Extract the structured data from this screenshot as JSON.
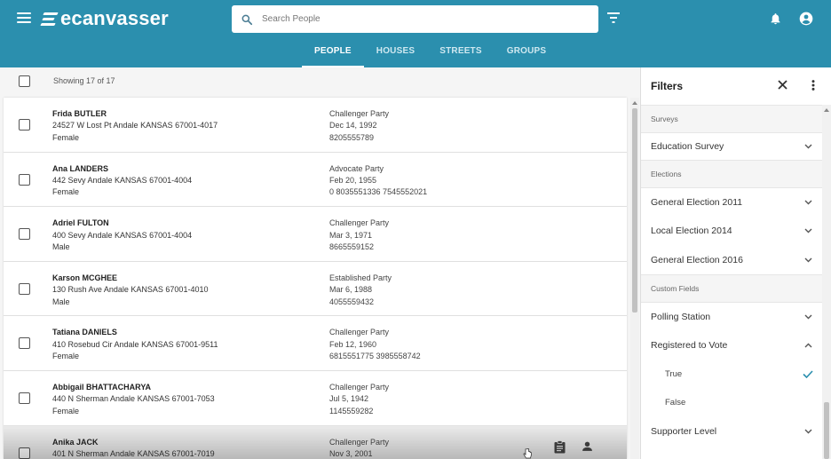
{
  "app": {
    "name": "ecanvasser",
    "brand_color": "#2b8fae"
  },
  "header": {
    "menu_icon": "hamburger-menu-icon",
    "search_placeholder": "Search People",
    "icons": [
      "search-icon",
      "filter-list-icon",
      "bell-icon",
      "account-circle-icon"
    ]
  },
  "tabs": [
    {
      "label": "PEOPLE",
      "active": true
    },
    {
      "label": "HOUSES",
      "active": false
    },
    {
      "label": "STREETS",
      "active": false
    },
    {
      "label": "GROUPS",
      "active": false
    }
  ],
  "list": {
    "showing": "Showing 17 of 17",
    "rows": [
      {
        "name": "Frida BUTLER",
        "address": "24527 W Lost Pt Andale KANSAS 67001-4017",
        "gender": "Female",
        "party": "Challenger Party",
        "dob": "Dec 14, 1992",
        "phone": "8205555789"
      },
      {
        "name": "Ana LANDERS",
        "address": "442 Sevy Andale KANSAS 67001-4004",
        "gender": "Female",
        "party": "Advocate Party",
        "dob": "Feb 20, 1955",
        "phone": "0 8035551336 7545552021"
      },
      {
        "name": "Adriel FULTON",
        "address": "400 Sevy Andale KANSAS 67001-4004",
        "gender": "Male",
        "party": "Challenger Party",
        "dob": "Mar 3, 1971",
        "phone": "8665559152"
      },
      {
        "name": "Karson MCGHEE",
        "address": "130 Rush Ave Andale KANSAS 67001-4010",
        "gender": "Male",
        "party": "Established Party",
        "dob": "Mar 6, 1988",
        "phone": "4055559432"
      },
      {
        "name": "Tatiana DANIELS",
        "address": "410 Rosebud Cir Andale KANSAS 67001-9511",
        "gender": "Female",
        "party": "Challenger Party",
        "dob": "Feb 12, 1960",
        "phone": "6815551775 3985558742"
      },
      {
        "name": "Abbigail BHATTACHARYA",
        "address": "440 N Sherman Andale KANSAS 67001-7053",
        "gender": "Female",
        "party": "Challenger Party",
        "dob": "Jul 5, 1942",
        "phone": "1145559282"
      },
      {
        "name": "Anika JACK",
        "address": "401 N Sherman Andale KANSAS 67001-7019",
        "gender": "",
        "party": "Challenger Party",
        "dob": "Nov 3, 2001",
        "phone": ""
      }
    ],
    "row_action_icons": [
      "clipboard-icon",
      "person-icon"
    ]
  },
  "filters": {
    "title": "Filters",
    "sections": [
      {
        "header": "Surveys",
        "items": [
          "Education Survey"
        ]
      },
      {
        "header": "Elections",
        "items": [
          "General Election 2011",
          "Local Election 2014",
          "General Election 2016"
        ]
      },
      {
        "header": "Custom Fields",
        "items": [
          "Polling Station",
          "Registered to Vote"
        ]
      }
    ],
    "registered_options": [
      {
        "label": "True",
        "selected": true
      },
      {
        "label": "False",
        "selected": false
      }
    ],
    "last_item": "Supporter Level"
  }
}
